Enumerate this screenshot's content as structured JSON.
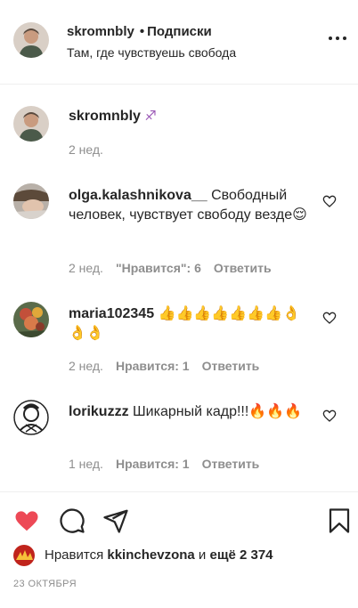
{
  "header": {
    "username": "skromnbly",
    "separator": "•",
    "follow_label": "Подписки",
    "caption": "Там, где чувствуешь свобода",
    "more_icon": "more-horizontal-icon"
  },
  "post_caption": {
    "username": "skromnbly",
    "emoji": "♐",
    "time": "2 нед."
  },
  "comments": [
    {
      "username": "olga.kalashnikova__",
      "text": "Свободный человек, чувствует свободу везде😌",
      "time": "2 нед.",
      "likes_label": "\"Нравится\": 6",
      "reply_label": "Ответить"
    },
    {
      "username": "maria102345",
      "text": "👍👍👍👍👍👍👍👌👌👌",
      "time": "2 нед.",
      "likes_label": "Нравится: 1",
      "reply_label": "Ответить"
    },
    {
      "username": "lorikuzzz",
      "text": "Шикарный кадр!!!🔥🔥🔥",
      "time": "1 нед.",
      "likes_label": "Нравится: 1",
      "reply_label": "Ответить"
    }
  ],
  "actions": {
    "like_color": "#ed4956",
    "icons": [
      "heart-icon",
      "comment-icon",
      "share-icon",
      "bookmark-icon"
    ]
  },
  "likes": {
    "prefix": "Нравится",
    "user": "kkinchevzona",
    "connector": "и",
    "others": "ещё 2 374"
  },
  "date": "23 ОКТЯБРЯ"
}
